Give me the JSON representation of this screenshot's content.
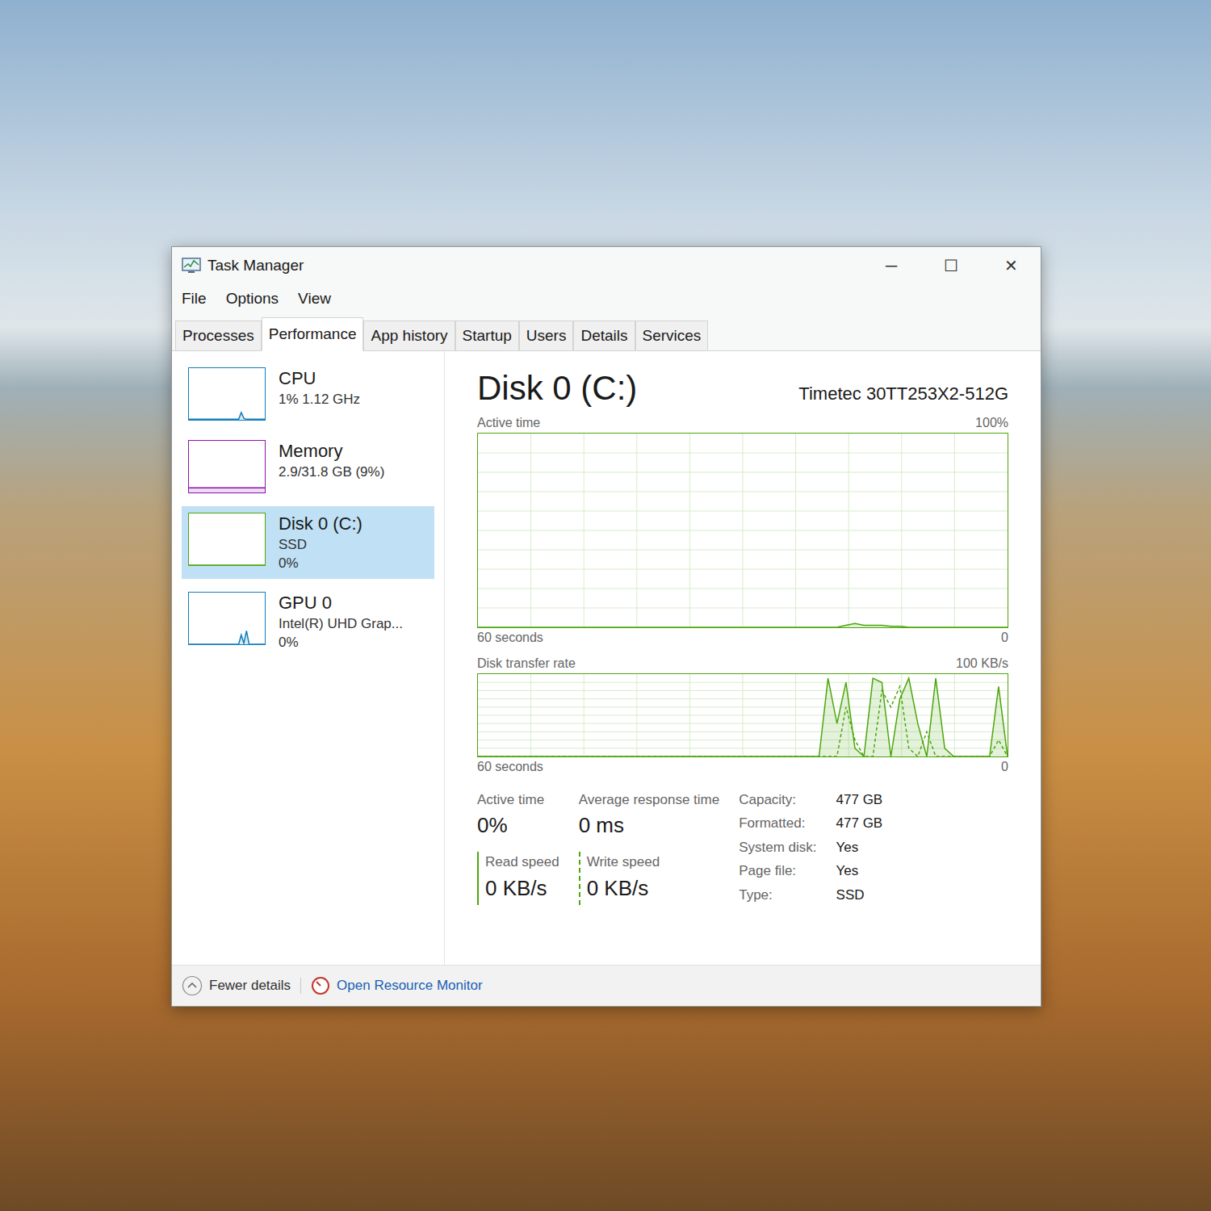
{
  "window": {
    "title": "Task Manager",
    "controls": [
      "─",
      "☐",
      "✕"
    ]
  },
  "menu": [
    "File",
    "Options",
    "View"
  ],
  "tabs": [
    {
      "label": "Processes",
      "selected": false
    },
    {
      "label": "Performance",
      "selected": true
    },
    {
      "label": "App history",
      "selected": false
    },
    {
      "label": "Startup",
      "selected": false
    },
    {
      "label": "Users",
      "selected": false
    },
    {
      "label": "Details",
      "selected": false
    },
    {
      "label": "Services",
      "selected": false
    }
  ],
  "sidebar": {
    "items": [
      {
        "name": "CPU",
        "lines": [
          "1% 1.12 GHz"
        ],
        "selected": false,
        "color": "#117dbb",
        "graph": [
          1,
          1,
          1,
          1,
          1,
          1,
          1,
          1,
          1,
          1,
          1,
          1,
          1,
          1,
          1,
          1,
          1,
          1,
          1,
          1,
          14,
          3,
          1,
          1,
          1,
          1,
          1,
          1,
          1,
          1
        ]
      },
      {
        "name": "Memory",
        "lines": [
          "2.9/31.8 GB (9%)"
        ],
        "selected": false,
        "color": "#8b12ae",
        "graph": [
          9,
          9,
          9,
          9,
          9,
          9,
          9,
          9,
          9,
          9,
          9,
          9,
          9,
          9,
          9,
          9,
          9,
          9,
          9,
          9,
          9,
          9,
          9,
          9,
          9,
          9,
          9,
          9,
          9,
          9
        ]
      },
      {
        "name": "Disk 0 (C:)",
        "lines": [
          "SSD",
          "0%"
        ],
        "selected": true,
        "color": "#4da60c",
        "graph": [
          0,
          0,
          0,
          0,
          0,
          0,
          0,
          0,
          0,
          0,
          0,
          0,
          0,
          0,
          0,
          0,
          0,
          0,
          0,
          0,
          0,
          0,
          0,
          0,
          0,
          0,
          0,
          0,
          0,
          0
        ]
      },
      {
        "name": "GPU 0",
        "lines": [
          "Intel(R) UHD Grap...",
          "0%"
        ],
        "selected": false,
        "color": "#117dbb",
        "graph": [
          0,
          0,
          0,
          0,
          0,
          0,
          0,
          0,
          0,
          0,
          0,
          0,
          0,
          0,
          0,
          0,
          0,
          0,
          0,
          0,
          18,
          2,
          26,
          0,
          0,
          0,
          0,
          0,
          0,
          0
        ]
      }
    ]
  },
  "detail": {
    "title": "Disk 0 (C:)",
    "model": "Timetec 30TT253X2-512G"
  },
  "active_chart": {
    "label": "Active time",
    "max": "100%",
    "time": "60 seconds",
    "min": "0",
    "scale": 100,
    "values": [
      0,
      0,
      0,
      0,
      0,
      0,
      0,
      0,
      0,
      0,
      0,
      0,
      0,
      0,
      0,
      0,
      0,
      0,
      0,
      0,
      0,
      0,
      0,
      0,
      0,
      0,
      0,
      0,
      0,
      0,
      0,
      0,
      0,
      0,
      0,
      0,
      0,
      0,
      0,
      0,
      0,
      1,
      2,
      1,
      1,
      1,
      0.5,
      0.5,
      0,
      0,
      0,
      0,
      0,
      0,
      0,
      0,
      0,
      0,
      0,
      0
    ]
  },
  "transfer_chart": {
    "label": "Disk transfer rate",
    "max": "100 KB/s",
    "time": "60 seconds",
    "min": "0",
    "scale": 100,
    "read": [
      0,
      0,
      0,
      0,
      0,
      0,
      0,
      0,
      0,
      0,
      0,
      0,
      0,
      0,
      0,
      0,
      0,
      0,
      0,
      0,
      0,
      0,
      0,
      0,
      0,
      0,
      0,
      0,
      0,
      0,
      0,
      0,
      0,
      0,
      0,
      0,
      0,
      0,
      0,
      95,
      40,
      90,
      10,
      0,
      95,
      90,
      0,
      70,
      95,
      40,
      0,
      95,
      10,
      0,
      0,
      0,
      0,
      0,
      85,
      0
    ],
    "write": [
      0,
      0,
      0,
      0,
      0,
      0,
      0,
      0,
      0,
      0,
      0,
      0,
      0,
      0,
      0,
      0,
      0,
      0,
      0,
      0,
      0,
      0,
      0,
      0,
      0,
      0,
      0,
      0,
      0,
      0,
      0,
      0,
      0,
      0,
      0,
      0,
      0,
      0,
      0,
      0,
      0,
      60,
      20,
      0,
      0,
      80,
      60,
      85,
      10,
      0,
      30,
      0,
      0,
      0,
      0,
      0,
      0,
      0,
      20,
      0
    ]
  },
  "stats": [
    {
      "label": "Active time",
      "value": "0%",
      "kind": "plain"
    },
    {
      "label": "Average response time",
      "value": "0 ms",
      "kind": "plain"
    },
    {
      "label": "Read speed",
      "value": "0 KB/s",
      "kind": "read"
    },
    {
      "label": "Write speed",
      "value": "0 KB/s",
      "kind": "write"
    }
  ],
  "properties": [
    {
      "label": "Capacity:",
      "value": "477 GB"
    },
    {
      "label": "Formatted:",
      "value": "477 GB"
    },
    {
      "label": "System disk:",
      "value": "Yes"
    },
    {
      "label": "Page file:",
      "value": "Yes"
    },
    {
      "label": "Type:",
      "value": "SSD"
    }
  ],
  "footer": {
    "fewer": "Fewer details",
    "monitor": "Open Resource Monitor"
  }
}
